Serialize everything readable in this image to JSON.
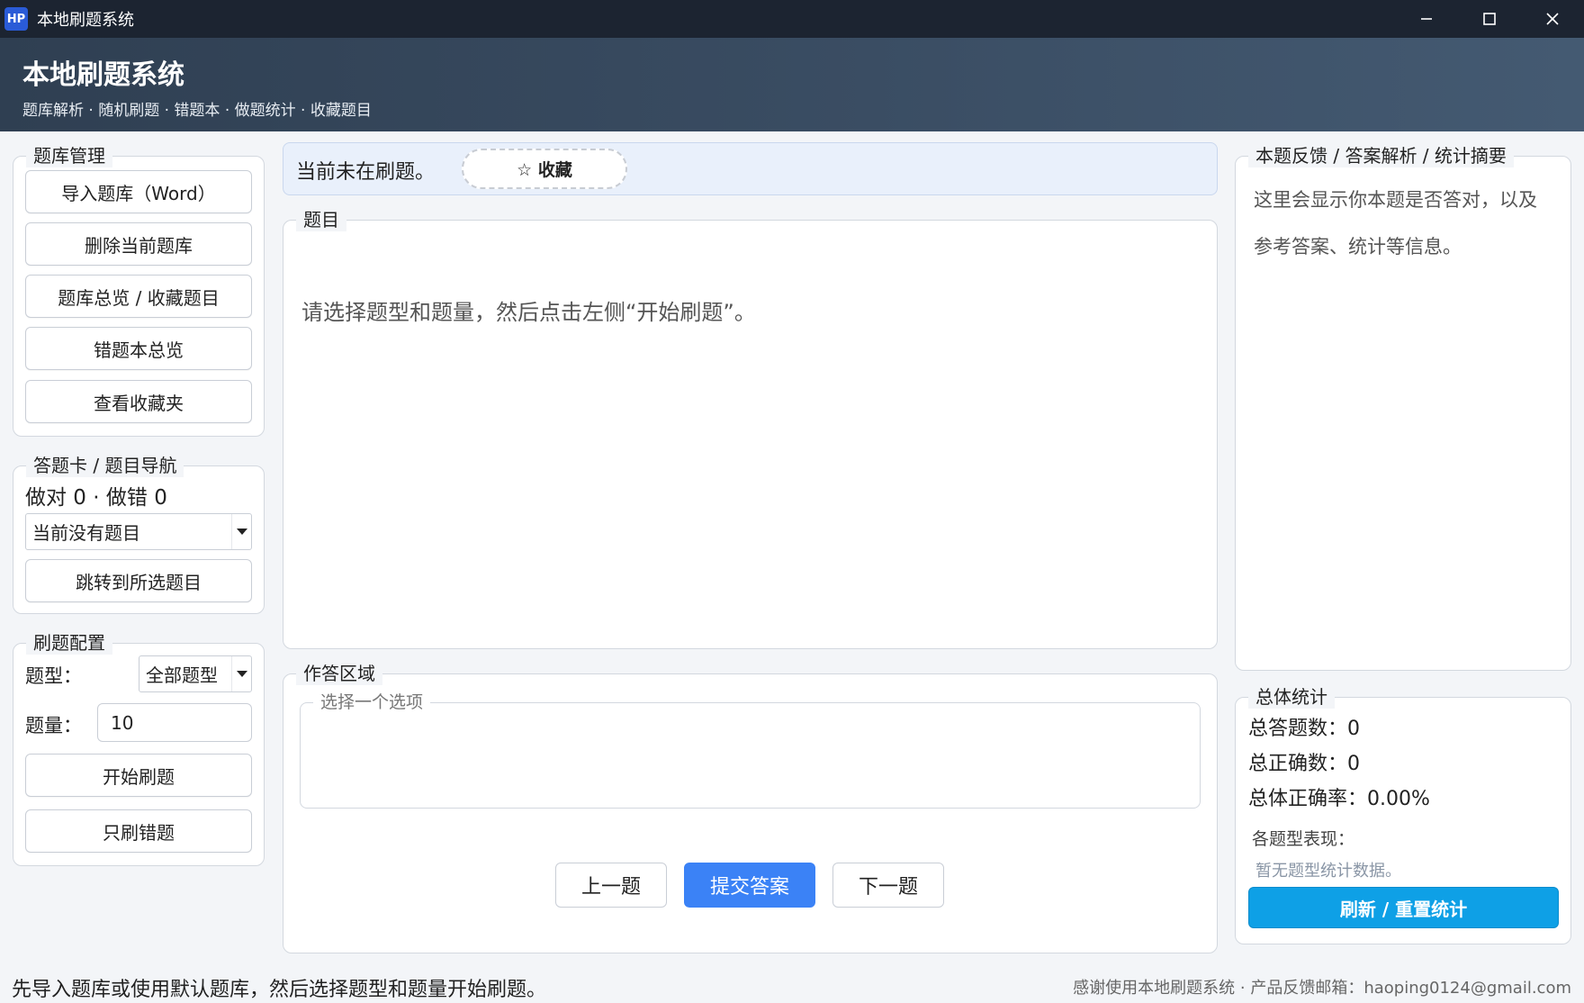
{
  "window": {
    "app_icon_text": "HP",
    "title": "本地刷题系统"
  },
  "header": {
    "title": "本地刷题系统",
    "subtitle": "题库解析 · 随机刷题 · 错题本 · 做题统计 · 收藏题目"
  },
  "library": {
    "title": "题库管理",
    "import_label": "导入题库（Word）",
    "delete_label": "删除当前题库",
    "overview_label": "题库总览 / 收藏题目",
    "wrong_overview_label": "错题本总览",
    "favorites_label": "查看收藏夹"
  },
  "answer_card": {
    "title": "答题卡 / 题目导航",
    "score_text": "做对 0 · 做错 0",
    "select_value": "当前没有题目",
    "jump_label": "跳转到所选题目"
  },
  "config": {
    "title": "刷题配置",
    "type_label": "题型：",
    "type_value": "全部题型",
    "count_label": "题量：",
    "count_value": "10",
    "start_label": "开始刷题",
    "wrong_only_label": "只刷错题"
  },
  "status": {
    "text": "当前未在刷题。",
    "favorite_label": "☆ 收藏"
  },
  "question": {
    "title": "题目",
    "text": "请选择题型和题量，然后点击左侧“开始刷题”。"
  },
  "answer_area": {
    "title": "作答区域",
    "options_title": "选择一个选项",
    "prev_label": "上一题",
    "submit_label": "提交答案",
    "next_label": "下一题"
  },
  "feedback": {
    "title": "本题反馈 / 答案解析 / 统计摘要",
    "text": "这里会显示你本题是否答对，以及参考答案、统计等信息。"
  },
  "stats": {
    "title": "总体统计",
    "total_answered": "总答题数：0",
    "total_correct": "总正确数：0",
    "accuracy": "总体正确率：0.00%",
    "by_type_label": "各题型表现：",
    "by_type_empty": "暂无题型统计数据。",
    "refresh_label": "刷新 / 重置统计"
  },
  "footer": {
    "hint": "先导入题库或使用默认题库，然后选择题型和题量开始刷题。",
    "credits": "感谢使用本地刷题系统 · 产品反馈邮箱：haoping0124@gmail.com"
  },
  "colors": {
    "titlebar": "#1c2431",
    "header": "#3a4d63",
    "primary_button": "#3b82f6",
    "refresh_button": "#0ea0e6",
    "status_bar": "#e9f0fb"
  }
}
